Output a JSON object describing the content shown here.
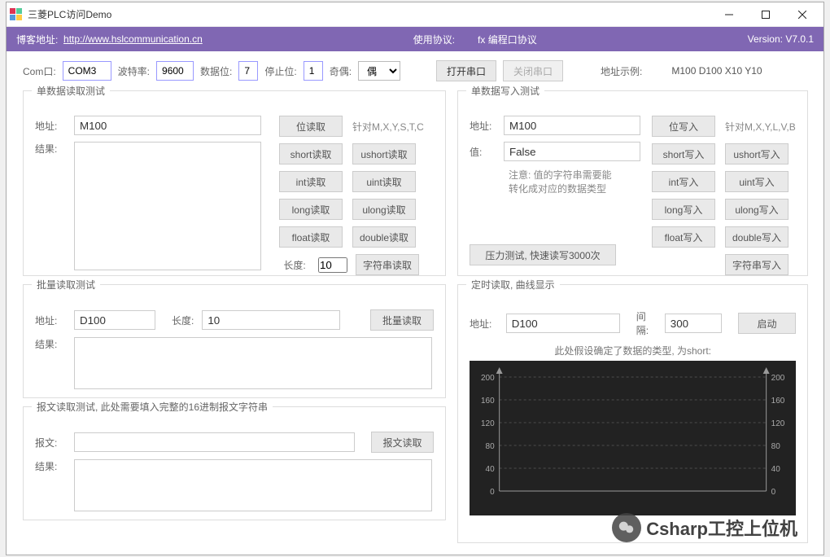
{
  "titlebar": {
    "title": "三菱PLC访问Demo"
  },
  "header": {
    "blog_label": "博客地址:",
    "blog_url": "http://www.hslcommunication.cn",
    "protocol_label": "使用协议:",
    "protocol_value": "fx 编程口协议",
    "version": "Version: V7.0.1"
  },
  "config": {
    "com_label": "Com口:",
    "com_value": "COM3",
    "baud_label": "波特率:",
    "baud_value": "9600",
    "databits_label": "数据位:",
    "databits_value": "7",
    "stopbits_label": "停止位:",
    "stopbits_value": "1",
    "parity_label": "奇偶:",
    "parity_value": "偶",
    "open_btn": "打开串口",
    "close_btn": "关闭串口",
    "addr_example_label": "地址示例:",
    "addr_example_value": "M100 D100 X10 Y10"
  },
  "single_read": {
    "legend": "单数据读取测试",
    "addr_label": "地址:",
    "addr_value": "M100",
    "result_label": "结果:",
    "len_label": "长度:",
    "len_value": "10",
    "hint": "针对M,X,Y,S,T,C",
    "buttons": {
      "bit": "位读取",
      "short": "short读取",
      "ushort": "ushort读取",
      "int": "int读取",
      "uint": "uint读取",
      "long": "long读取",
      "ulong": "ulong读取",
      "float": "float读取",
      "double": "double读取",
      "string": "字符串读取"
    }
  },
  "single_write": {
    "legend": "单数据写入测试",
    "addr_label": "地址:",
    "addr_value": "M100",
    "value_label": "值:",
    "value_value": "False",
    "hint1": "注意: 值的字符串需要能",
    "hint2": "转化成对应的数据类型",
    "hint_right": "针对M,X,Y,L,V,B",
    "pressure_btn": "压力测试, 快速读写3000次",
    "buttons": {
      "bit": "位写入",
      "short": "short写入",
      "ushort": "ushort写入",
      "int": "int写入",
      "uint": "uint写入",
      "long": "long写入",
      "ulong": "ulong写入",
      "float": "float写入",
      "double": "double写入",
      "string": "字符串写入"
    }
  },
  "batch_read": {
    "legend": "批量读取测试",
    "addr_label": "地址:",
    "addr_value": "D100",
    "len_label": "长度:",
    "len_value": "10",
    "result_label": "结果:",
    "btn": "批量读取"
  },
  "msg_read": {
    "legend": "报文读取测试, 此处需要填入完整的16进制报文字符串",
    "msg_label": "报文:",
    "result_label": "结果:",
    "btn": "报文读取"
  },
  "timed": {
    "legend": "定时读取, 曲线显示",
    "addr_label": "地址:",
    "addr_value": "D100",
    "interval_label": "间隔:",
    "interval_value": "300",
    "start_btn": "启动",
    "chart_title": "此处假设确定了数据的类型, 为short:"
  },
  "chart_data": {
    "type": "line",
    "ylim": [
      0,
      200
    ],
    "yticks": [
      0,
      40,
      80,
      120,
      160,
      200
    ],
    "series": [
      {
        "name": "short",
        "values": []
      }
    ]
  },
  "watermark": "Csharp工控上位机"
}
